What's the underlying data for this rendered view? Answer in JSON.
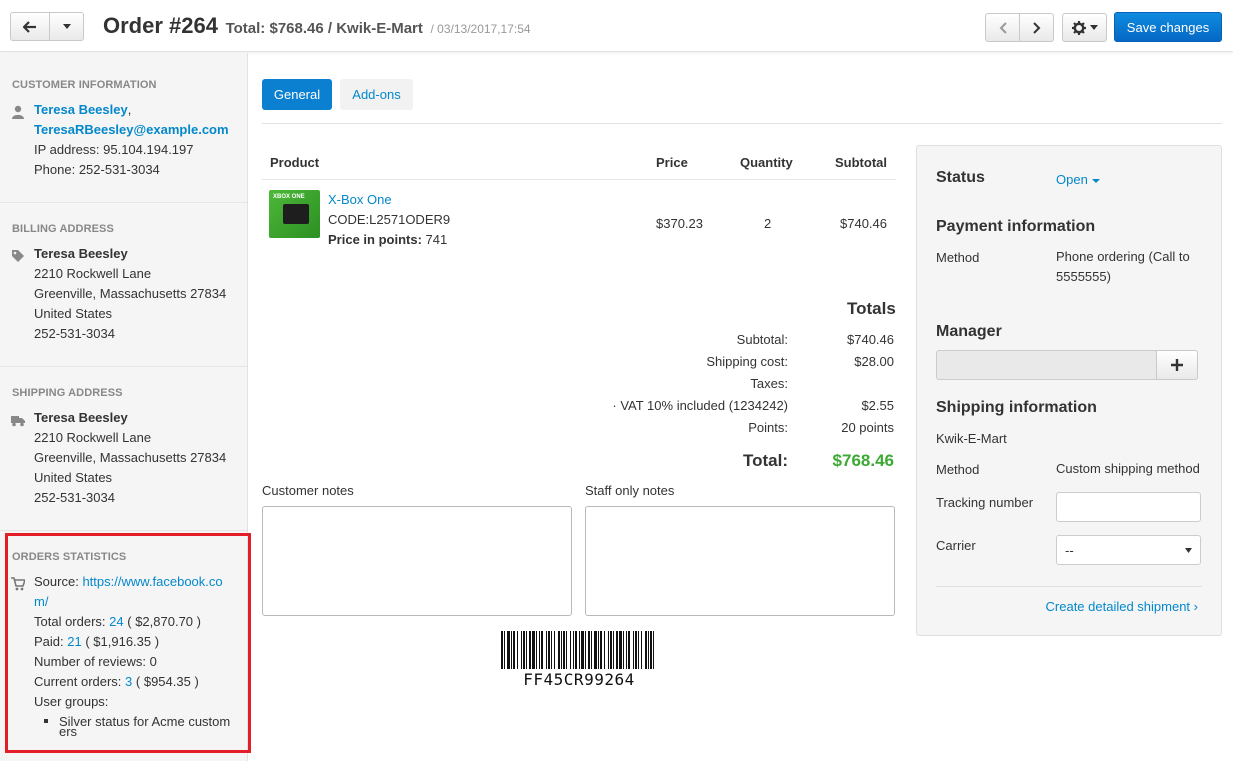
{
  "header": {
    "order_title": "Order #264",
    "order_total": "Total: $768.46 / Kwik-E-Mart",
    "order_date": "/ 03/13/2017,17:54",
    "save_label": "Save changes"
  },
  "sidebar": {
    "customer": {
      "title": "Customer information",
      "name": "Teresa Beesley",
      "name_sep": ",",
      "email": "TeresaRBeesley@example.com",
      "ip": "IP address: 95.104.194.197",
      "phone": "Phone: 252-531-3034"
    },
    "billing": {
      "title": "Billing address",
      "name": "Teresa Beesley",
      "street": "2210 Rockwell Lane",
      "city": "Greenville, Massachusetts 27834",
      "country": "United States",
      "phone": "252-531-3034"
    },
    "shipping": {
      "title": "Shipping address",
      "name": "Teresa Beesley",
      "street": "2210 Rockwell Lane",
      "city": "Greenville, Massachusetts 27834",
      "country": "United States",
      "phone": "252-531-3034"
    },
    "stats": {
      "title": "Orders statistics",
      "source_label": "Source:",
      "source_line1": "https://www.facebook.co",
      "source_line2": "m/",
      "total_label": "Total orders:",
      "total_count": "24",
      "total_amount": "( $2,870.70 )",
      "paid_label": "Paid:",
      "paid_count": "21",
      "paid_amount": "( $1,916.35 )",
      "reviews": "Number of reviews: 0",
      "current_label": "Current orders:",
      "current_count": "3",
      "current_amount": "( $954.35 )",
      "groups_label": "User groups:",
      "group_line1": "Silver status for Acme custom",
      "group_line2": "ers"
    }
  },
  "tabs": [
    {
      "label": "General",
      "active": true
    },
    {
      "label": "Add-ons",
      "active": false
    }
  ],
  "products": {
    "columns": [
      "Product",
      "Price",
      "Quantity",
      "Subtotal"
    ],
    "image_label": "XBOX ONE",
    "rows": [
      {
        "name": "X-Box One",
        "code": "CODE:L2571ODER9",
        "points_label": "Price in points:",
        "points": "741",
        "price": "$370.23",
        "quantity": "2",
        "subtotal": "$740.46"
      }
    ]
  },
  "totals": {
    "heading": "Totals",
    "rows": [
      {
        "label": "Subtotal:",
        "value": "$740.46"
      },
      {
        "label": "Shipping cost:",
        "value": "$28.00"
      },
      {
        "label": "Taxes:",
        "value": ""
      },
      {
        "label": "· VAT 10% included (1234242)",
        "value": "$2.55"
      },
      {
        "label": "Points:",
        "value": "20 points"
      }
    ],
    "grand_label": "Total:",
    "grand_value": "$768.46"
  },
  "notes": {
    "customer_label": "Customer notes",
    "staff_label": "Staff only notes"
  },
  "barcode": {
    "text": "FF45CR99264"
  },
  "panel": {
    "status_label": "Status",
    "status_value": "Open",
    "payment_heading": "Payment information",
    "method_label": "Method",
    "payment_method_line1": "Phone ordering (Call to",
    "payment_method_line2": "5555555)",
    "manager_heading": "Manager",
    "shipping_heading": "Shipping information",
    "shipping_company": "Kwik-E-Mart",
    "shipping_method": "Custom shipping method",
    "tracking_label": "Tracking number",
    "carrier_label": "Carrier",
    "carrier_value": "--",
    "shipment_link": "Create detailed shipment ›"
  },
  "colors": {
    "accent": "#0388cc",
    "primary_button": "#0b7fd0",
    "total_green": "#3ca934",
    "highlight": "#e41e26"
  }
}
